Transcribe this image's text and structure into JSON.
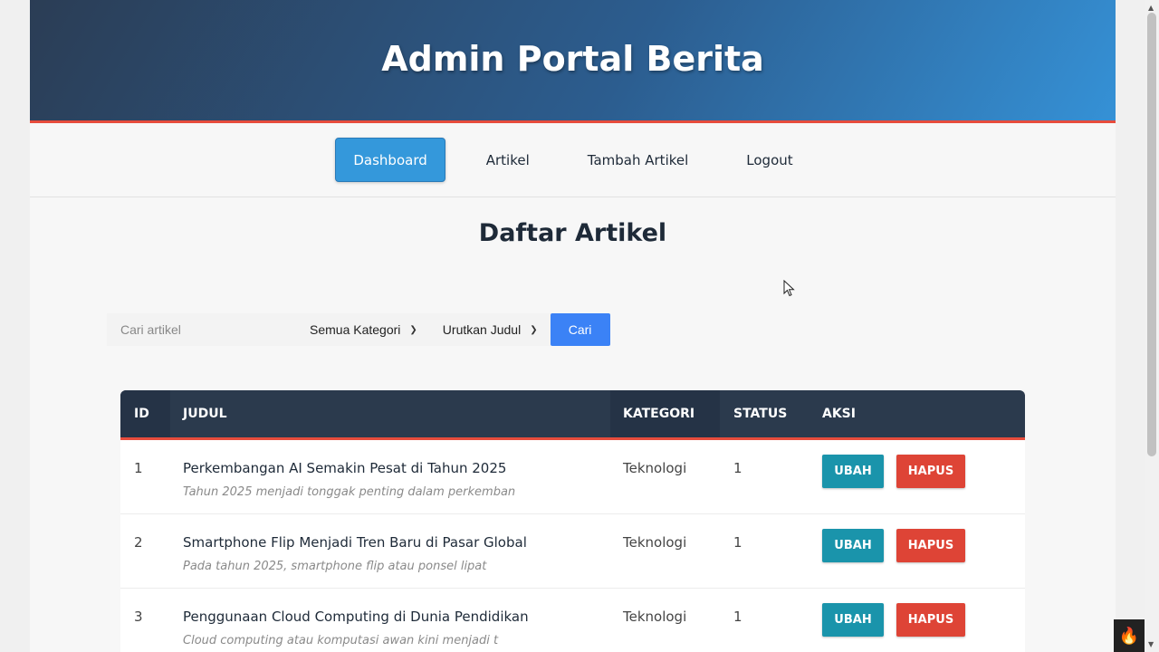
{
  "header": {
    "title": "Admin Portal Berita"
  },
  "nav": {
    "items": [
      {
        "label": "Dashboard",
        "active": true
      },
      {
        "label": "Artikel",
        "active": false
      },
      {
        "label": "Tambah Artikel",
        "active": false
      },
      {
        "label": "Logout",
        "active": false
      }
    ]
  },
  "main": {
    "title": "Daftar Artikel"
  },
  "search": {
    "placeholder": "Cari artikel",
    "category_select": "Semua Kategori",
    "sort_select": "Urutkan Judul",
    "button_label": "Cari"
  },
  "table": {
    "headers": {
      "id": "ID",
      "judul": "JUDUL",
      "kategori": "KATEGORI",
      "status": "STATUS",
      "aksi": "AKSI"
    },
    "rows": [
      {
        "id": "1",
        "title": "Perkembangan AI Semakin Pesat di Tahun 2025",
        "excerpt": "Tahun 2025 menjadi tonggak penting dalam perkemban",
        "kategori": "Teknologi",
        "status": "1",
        "edit": "UBAH",
        "delete": "HAPUS"
      },
      {
        "id": "2",
        "title": "Smartphone Flip Menjadi Tren Baru di Pasar Global",
        "excerpt": "Pada tahun 2025, smartphone flip atau ponsel lipat",
        "kategori": "Teknologi",
        "status": "1",
        "edit": "UBAH",
        "delete": "HAPUS"
      },
      {
        "id": "3",
        "title": "Penggunaan Cloud Computing di Dunia Pendidikan",
        "excerpt": "Cloud computing atau komputasi awan kini menjadi t",
        "kategori": "Teknologi",
        "status": "1",
        "edit": "UBAH",
        "delete": "HAPUS"
      }
    ]
  },
  "colors": {
    "accent": "#3498db",
    "header_border": "#e74c3c",
    "edit_button": "#1a94ab",
    "delete_button": "#de4436",
    "search_button": "#3b82f6"
  },
  "icons": {
    "corner_badge": "flame-icon"
  }
}
